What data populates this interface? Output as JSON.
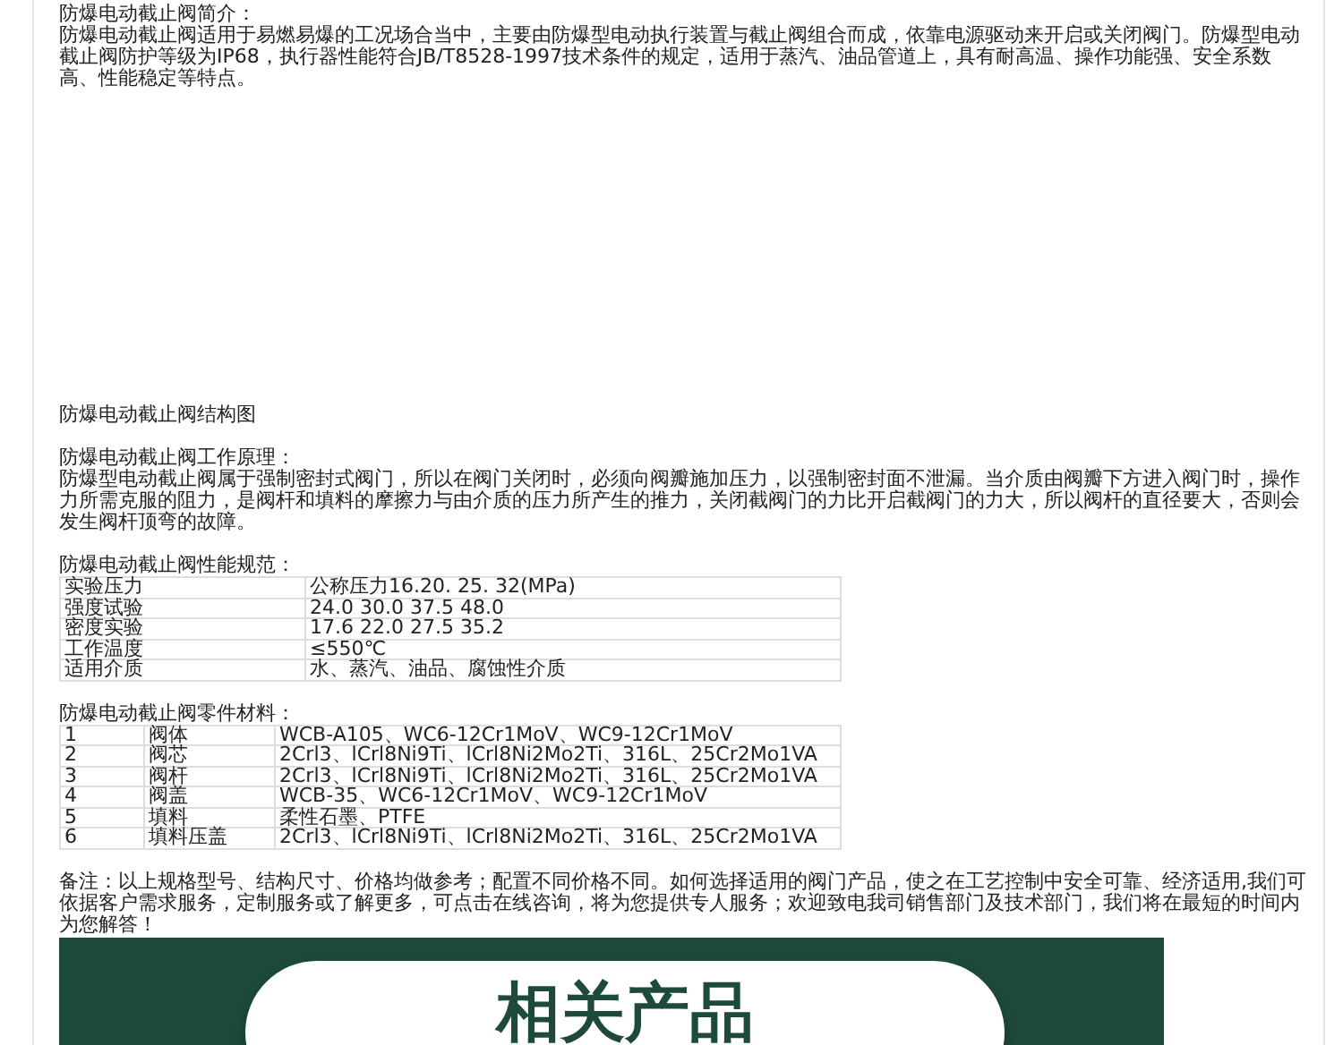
{
  "intro": {
    "heading": "防爆电动截止阀简介：",
    "text": "防爆电动截止阀适用于易燃易爆的工况场合当中，主要由防爆型电动执行装置与截止阀组合而成，依靠电源驱动来开启或关闭阀门。防爆型电动截止阀防护等级为IP68，执行器性能符合JB/T8528-1997技术条件的规定，适用于蒸汽、油品管道上，具有耐高温、操作功能强、安全系数高、性能稳定等特点。"
  },
  "structure": {
    "heading": "防爆电动截止阀结构图"
  },
  "principle": {
    "heading": "防爆电动截止阀工作原理：",
    "text": "防爆型电动截止阀属于强制密封式阀门，所以在阀门关闭时，必须向阀瓣施加压力，以强制密封面不泄漏。当介质由阀瓣下方进入阀门时，操作力所需克服的阻力，是阀杆和填料的摩擦力与由介质的压力所产生的推力，关闭截阀门的力比开启截阀门的力大，所以阀杆的直径要大，否则会发生阀杆顶弯的故障。"
  },
  "specs": {
    "heading": "防爆电动截止阀性能规范：",
    "rows": [
      [
        "实验压力",
        "公称压力16.20. 25. 32(MPa)"
      ],
      [
        "强度试验",
        "24.0 30.0 37.5 48.0"
      ],
      [
        "密度实验",
        "17.6 22.0 27.5 35.2"
      ],
      [
        "工作温度",
        "≤550℃"
      ],
      [
        "适用介质",
        "水、蒸汽、油品、腐蚀性介质"
      ]
    ]
  },
  "materials": {
    "heading": "防爆电动截止阀零件材料：",
    "rows": [
      [
        "1",
        "阀体",
        "WCB-A105、WC6-12Cr1MoV、WC9-12Cr1MoV"
      ],
      [
        "2",
        "阀芯",
        "2Crl3、lCrl8Ni9Ti、lCrl8Ni2Mo2Ti、316L、25Cr2Mo1VA"
      ],
      [
        "3",
        "阀杆",
        "2Crl3、lCrl8Ni9Ti、lCrl8Ni2Mo2Ti、316L、25Cr2Mo1VA"
      ],
      [
        "4",
        "阀盖",
        "WCB-35、WC6-12Cr1MoV、WC9-12Cr1MoV"
      ],
      [
        "5",
        "填料",
        "柔性石墨、PTFE"
      ],
      [
        "6",
        "填料压盖",
        "2Crl3、lCrl8Ni9Ti、lCrl8Ni2Mo2Ti、316L、25Cr2Mo1VA"
      ]
    ]
  },
  "note": "备注：以上规格型号、结构尺寸、价格均做参考；配置不同价格不同。如何选择适用的阀门产品，使之在工艺控制中安全可靠、经济适用,我们可依据客户需求服务，定制服务或了解更多，可点击在线咨询，将为您提供专人服务；欢迎致电我司销售部门及技术部门，我们将在最短的时间内为您解答！",
  "banner": {
    "title": "相关产品"
  }
}
